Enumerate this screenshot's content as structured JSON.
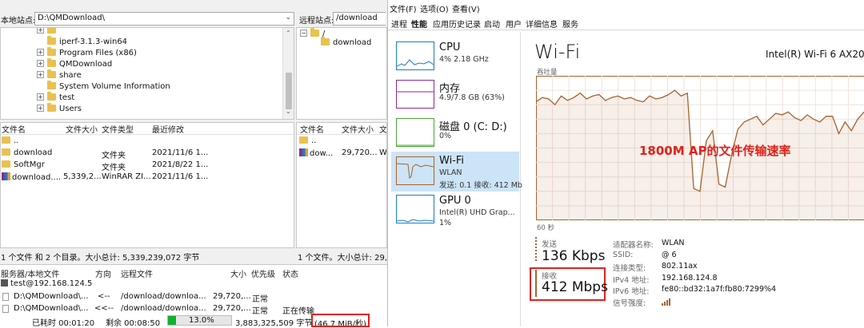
{
  "colors": {
    "wifi_accent": "#a7622e",
    "cpu_accent": "#1a7ec2",
    "mem_accent": "#8f2a8f",
    "disk_accent": "#4aa63a",
    "annotation_red": "#e0221b",
    "progress_green": "#11b12e"
  },
  "filezilla": {
    "local_site_label": "本地站点:",
    "local_path": "D:\\QMDownload\\",
    "remote_site_label": "远程站点:",
    "remote_path": "/download",
    "local_tree": [
      {
        "label": "iperf-3.1.3-win64",
        "expand": ""
      },
      {
        "label": "Program Files (x86)",
        "expand": "+"
      },
      {
        "label": "QMDownload",
        "expand": "+"
      },
      {
        "label": "share",
        "expand": "+"
      },
      {
        "label": "System Volume Information",
        "expand": ""
      },
      {
        "label": "test",
        "expand": "+"
      },
      {
        "label": "Users",
        "expand": "+"
      }
    ],
    "remote_tree": [
      {
        "label": "/",
        "expand": "-"
      },
      {
        "label": "download",
        "expand": ""
      }
    ],
    "local_columns": {
      "name": "文件名",
      "size": "文件大小",
      "type": "文件类型",
      "modified": "最近修改"
    },
    "local_files": [
      {
        "name": "..",
        "size": "",
        "type": "",
        "modified": "",
        "icon": "folder-icon"
      },
      {
        "name": "download",
        "size": "",
        "type": "文件夹",
        "modified": "2021/11/6 1...",
        "icon": "folder-icon"
      },
      {
        "name": "SoftMgr",
        "size": "",
        "type": "文件夹",
        "modified": "2021/8/22 1...",
        "icon": "folder-icon"
      },
      {
        "name": "download....",
        "size": "5,339,2...",
        "type": "WinRAR ZI...",
        "modified": "2021/11/6 1...",
        "icon": "winrar-icon"
      }
    ],
    "remote_columns": {
      "name": "文件名",
      "size": "文件大小",
      "type": "文"
    },
    "remote_files": [
      {
        "name": "..",
        "size": "",
        "type": "",
        "icon": "folder-icon"
      },
      {
        "name": "dow...",
        "size": "29,720...",
        "type": "W",
        "icon": "winrar-icon"
      }
    ],
    "local_status": "1 个文件 和 2 个目录。大小总计: 5,339,239,072 字节",
    "remote_status": "1 个文件。大小总计: 29,72",
    "queue_columns": {
      "server": "服务器/本地文件",
      "direction": "方向",
      "remote": "远程文件",
      "size": "大小",
      "priority": "优先级",
      "status": "状态"
    },
    "queue_server": "test@192.168.124.5",
    "queue_rows": [
      {
        "local": "D:\\QMDownload\\...",
        "direction": "<--",
        "remote": "/download/downloa...",
        "size": "29,720,...",
        "priority": "正常",
        "status": ""
      },
      {
        "local": "D:\\QMDownload\\...",
        "direction": "<<--",
        "remote": "/download/downloa...",
        "size": "29,720,...",
        "priority": "正常",
        "status": "正在传输"
      }
    ],
    "elapsed": "已耗时 00:01:20",
    "remaining": "剩余 00:08:50",
    "progress_percent": 13.0,
    "progress_text": "13.0%",
    "transferred": "3,883,325,509 字节",
    "speed": "(46.7 MiB/秒)"
  },
  "taskmanager": {
    "menu": [
      "文件(F)",
      "选项(O)",
      "查看(V)"
    ],
    "tabs": [
      "进程",
      "性能",
      "应用历史记录",
      "启动",
      "用户",
      "详细信息",
      "服务"
    ],
    "active_tab_index": 1,
    "sidebar": [
      {
        "title": "CPU",
        "sub": "4% 2.18 GHz",
        "sub2": ""
      },
      {
        "title": "内存",
        "sub": "4.9/7.8 GB (63%)",
        "sub2": ""
      },
      {
        "title": "磁盘 0 (C: D:)",
        "sub": "0%",
        "sub2": ""
      },
      {
        "title": "Wi-Fi",
        "sub": "WLAN",
        "sub2": "发送: 0.1 接收: 412 Mb"
      },
      {
        "title": "GPU 0",
        "sub": "Intel(R) UHD Grap...",
        "sub2": "1%"
      }
    ],
    "detail_title": "Wi-Fi",
    "adapter_name": "Intel(R) Wi-Fi 6 AX20",
    "throughput_label": "吞吐量",
    "time_label": "60 秒",
    "annotation": "1800M AP的文件传输速率",
    "send_label": "发送",
    "send_value": "136 Kbps",
    "recv_label": "接收",
    "recv_value": "412 Mbps",
    "info": [
      {
        "label": "适配器名称:",
        "value": "WLAN"
      },
      {
        "label": "SSID:",
        "value": "@        6"
      },
      {
        "label": "连接类型:",
        "value": "802.11ax"
      },
      {
        "label": "IPv4 地址:",
        "value": "192.168.124.8"
      },
      {
        "label": "IPv6 地址:",
        "value": "fe80::bd32:1a7f:fb80:7299%4"
      },
      {
        "label": "信号强度:",
        "value": ""
      }
    ]
  },
  "chart_data": {
    "type": "line",
    "title": "",
    "xlabel": "60 秒",
    "ylabel": "吞吐量",
    "grid": true,
    "series": [
      {
        "values": [
          0.82,
          0.85,
          0.84,
          0.8,
          0.86,
          0.83,
          0.85,
          0.88,
          0.84,
          0.86,
          0.87,
          0.83,
          0.85,
          0.86,
          0.84,
          0.85,
          0.83,
          0.82,
          0.86,
          0.84,
          0.85,
          0.87,
          0.9,
          0.86,
          0.88,
          0.22,
          0.2,
          0.55,
          0.62,
          0.25,
          0.23,
          0.45,
          0.63,
          0.68,
          0.7,
          0.72,
          0.66,
          0.7,
          0.74,
          0.73,
          0.75,
          0.71,
          0.69,
          0.73,
          0.7,
          0.68,
          0.72,
          0.72,
          0.6,
          0.68,
          0.62,
          0.7,
          0.75
        ]
      }
    ]
  }
}
